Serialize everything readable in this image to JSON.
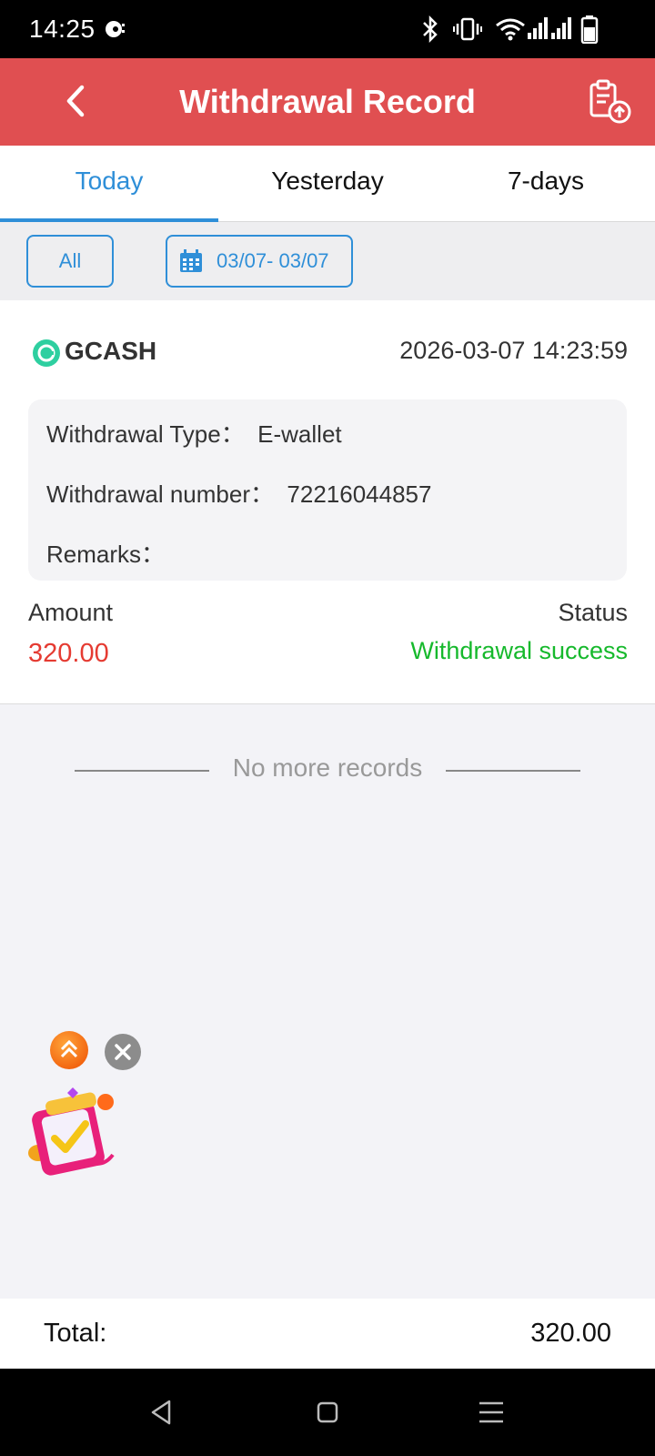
{
  "status_bar": {
    "time": "14:25"
  },
  "header": {
    "title": "Withdrawal Record"
  },
  "tabs": [
    {
      "label": "Today",
      "active": true
    },
    {
      "label": "Yesterday",
      "active": false
    },
    {
      "label": "7-days",
      "active": false
    }
  ],
  "filters": {
    "all_label": "All",
    "date_range": "03/07- 03/07"
  },
  "record": {
    "provider": "GCASH",
    "datetime": "2026-03-07 14:23:59",
    "type_row": "Withdrawal Type：  E-wallet",
    "number_row": "Withdrawal number：  72216044857",
    "remarks_row": "Remarks：",
    "amount_label": "Amount",
    "amount_value": "320.00",
    "status_label": "Status",
    "status_value": "Withdrawal success"
  },
  "list_end_text": "No more records",
  "footer": {
    "total_label": "Total:",
    "total_value": "320.00"
  },
  "colors": {
    "header_bg": "#e04f51",
    "accent": "#2f8fd8",
    "amount": "#e53b32",
    "success": "#16b92c"
  }
}
